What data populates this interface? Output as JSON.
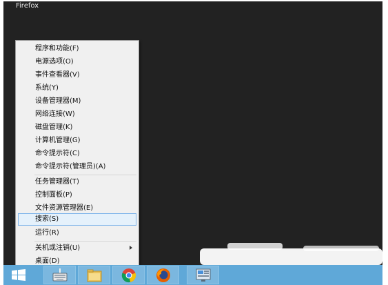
{
  "window": {
    "title": "Firefox"
  },
  "context_menu": {
    "items": [
      {
        "label": "程序和功能(F)"
      },
      {
        "label": "电源选项(O)"
      },
      {
        "label": "事件查看器(V)"
      },
      {
        "label": "系统(Y)"
      },
      {
        "label": "设备管理器(M)"
      },
      {
        "label": "网络连接(W)"
      },
      {
        "label": "磁盘管理(K)"
      },
      {
        "label": "计算机管理(G)"
      },
      {
        "label": "命令提示符(C)"
      },
      {
        "label": "命令提示符(管理员)(A)"
      },
      {
        "label": "任务管理器(T)"
      },
      {
        "label": "控制面板(P)"
      },
      {
        "label": "文件资源管理器(E)"
      },
      {
        "label": "搜索(S)",
        "highlighted": true
      },
      {
        "label": "运行(R)"
      },
      {
        "label": "关机或注销(U)",
        "has_submenu": true
      },
      {
        "label": "桌面(D)"
      }
    ]
  },
  "taskbar": {
    "icons": [
      "windows-logo-icon",
      "keyboard-icon",
      "file-explorer-icon",
      "chrome-icon",
      "firefox-icon",
      "control-panel-icon"
    ]
  },
  "colors": {
    "desktop": "#222222",
    "taskbar": "#5fa8d8",
    "menu_background": "#f0f0f0",
    "menu_highlight": "#e5f1fb",
    "menu_highlight_border": "#7eb4ea"
  }
}
